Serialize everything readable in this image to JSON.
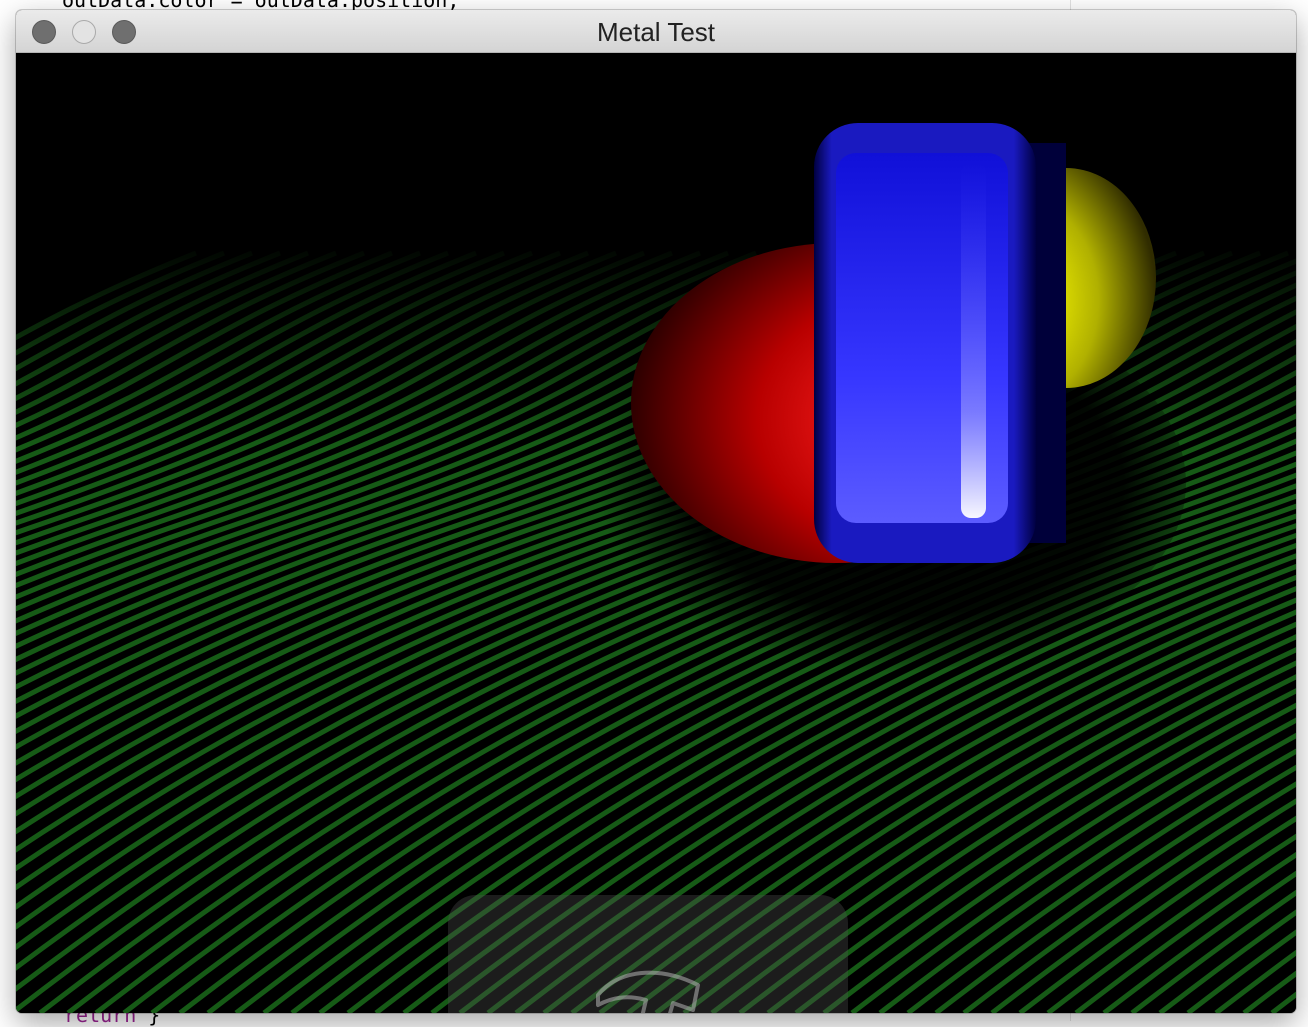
{
  "window": {
    "title": "Metal Test",
    "traffic_lights": [
      "close-button",
      "minimize-button",
      "zoom-button"
    ]
  },
  "background_editor": {
    "top_line": "outData.color = outData.position;",
    "bottom_line_keyword": "return",
    "bottom_line_rest": " }"
  },
  "scene": {
    "description_colors": {
      "background": "#000000",
      "floor_stripes": "#1a6a1a",
      "red_sphere": "#e00000",
      "blue_box": "#2424ff",
      "yellow_sphere": "#f0f000"
    }
  },
  "hud": {
    "icon": "hammer-icon"
  }
}
